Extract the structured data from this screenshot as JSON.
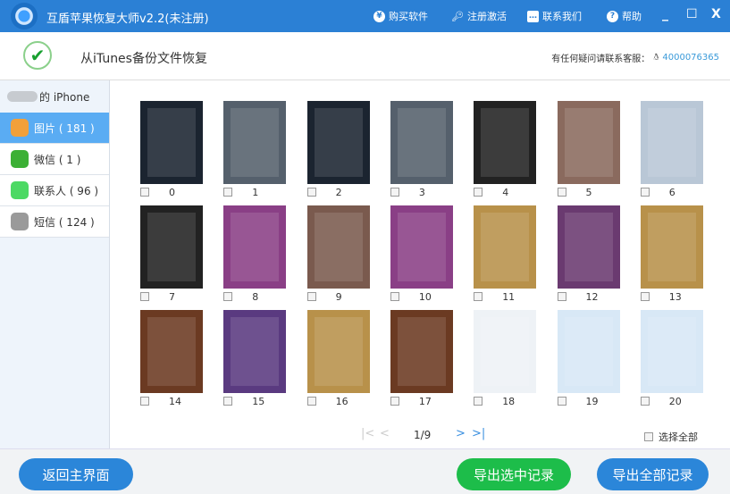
{
  "titlebar": {
    "title": "互盾苹果恢复大师v2.2(未注册)",
    "buy": "购买软件",
    "register": "注册激活",
    "contact": "联系我们",
    "help": "帮助",
    "minimize": "_",
    "maximize": "☐",
    "close": "X"
  },
  "header": {
    "title": "从iTunes备份文件恢复",
    "help_text": "有任何疑问请联系客服：",
    "phone": "4000076365"
  },
  "sidebar": {
    "device": "的 iPhone",
    "items": [
      {
        "label": "图片 ( 181 )",
        "icon": "photos-icon",
        "color": "#f2a03a",
        "selected": true
      },
      {
        "label": "微信 ( 1 )",
        "icon": "wechat-icon",
        "color": "#3cb035",
        "selected": false
      },
      {
        "label": "联系人 ( 96 )",
        "icon": "messages-icon",
        "color": "#4cd964",
        "selected": false
      },
      {
        "label": "短信 ( 124 )",
        "icon": "contacts-icon",
        "color": "#9a9a9a",
        "selected": false
      }
    ]
  },
  "photos": [
    {
      "label": "0",
      "color": "#1b2430"
    },
    {
      "label": "1",
      "color": "#55606c"
    },
    {
      "label": "2",
      "color": "#1b2430"
    },
    {
      "label": "3",
      "color": "#55606c"
    },
    {
      "label": "4",
      "color": "#222"
    },
    {
      "label": "5",
      "color": "#8a6a5e"
    },
    {
      "label": "6",
      "color": "#b9c7d6"
    },
    {
      "label": "7",
      "color": "#222"
    },
    {
      "label": "8",
      "color": "#8a3f86"
    },
    {
      "label": "9",
      "color": "#7a5a4e"
    },
    {
      "label": "10",
      "color": "#8a3f86"
    },
    {
      "label": "11",
      "color": "#b8914a"
    },
    {
      "label": "12",
      "color": "#6a3a70"
    },
    {
      "label": "13",
      "color": "#b8914a"
    },
    {
      "label": "14",
      "color": "#6b3a22"
    },
    {
      "label": "15",
      "color": "#5a3a80"
    },
    {
      "label": "16",
      "color": "#b8914a"
    },
    {
      "label": "17",
      "color": "#6b3a22"
    },
    {
      "label": "18",
      "color": "#eef2f6"
    },
    {
      "label": "19",
      "color": "#d8e8f6"
    },
    {
      "label": "20",
      "color": "#d8e8f6"
    }
  ],
  "pager": {
    "first": "|<",
    "prev": "<",
    "page": "1/9",
    "next": ">",
    "last": ">|"
  },
  "select_all": "选择全部",
  "buttons": {
    "back": "返回主界面",
    "export_selected": "导出选中记录",
    "export_all": "导出全部记录"
  },
  "colors": {
    "titlebar": "#2b80d5",
    "selected": "#5aacf3",
    "green": "#1dbd4a",
    "blue": "#2b86d9"
  }
}
